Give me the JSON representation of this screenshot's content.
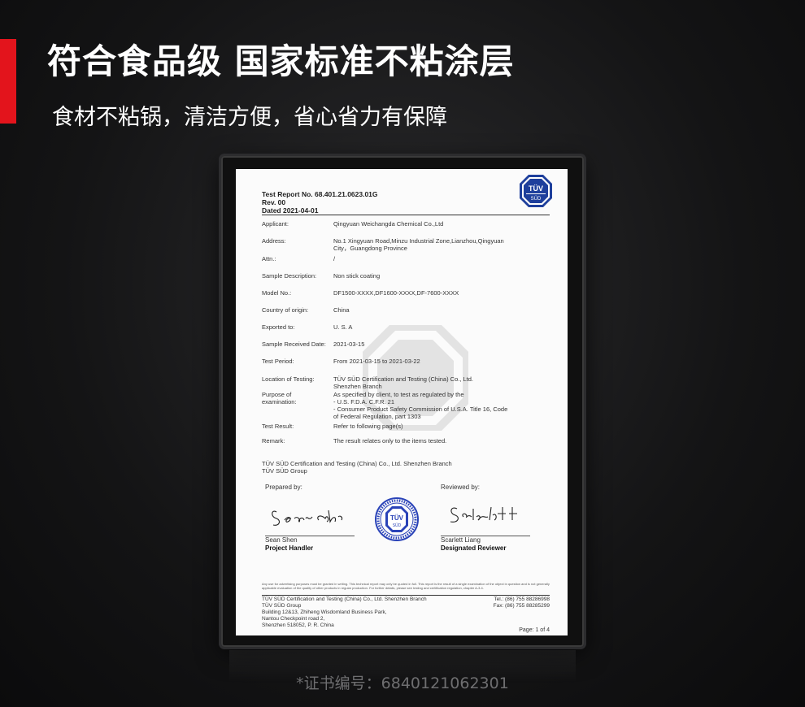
{
  "colors": {
    "accent": "#e3141c",
    "background": "#161617",
    "tuv_blue": "#1e3f9c"
  },
  "header": {
    "headline": "符合食品级 国家标准不粘涂层",
    "subline": "食材不粘锅，清洁方便，省心省力有保障"
  },
  "certificate": {
    "logo_text": "TÜV",
    "logo_subtext": "SÜD",
    "report_no": "Test Report No. 68.401.21.0623.01G",
    "rev": "Rev. 00",
    "dated": "Dated 2021-04-01",
    "fields": [
      {
        "label": "Applicant:",
        "value": [
          "Qingyuan Weichangda Chemical Co.,Ltd"
        ]
      },
      {
        "label": "Address:",
        "value": [
          "No.1 Xingyuan Road,Minzu Industrial Zone,Lianzhou,Qingyuan",
          "City，Guangdong Province"
        ]
      },
      {
        "label": "Attn.:",
        "value": [
          "/"
        ]
      },
      {
        "label": "Sample Description:",
        "value": [
          "Non stick coating"
        ]
      },
      {
        "label": "Model No.:",
        "value": [
          "DF1500-XXXX,DF1600-XXXX,DF-7600-XXXX"
        ]
      },
      {
        "label": "Country of origin:",
        "value": [
          "China"
        ]
      },
      {
        "label": "Exported to:",
        "value": [
          "U. S. A"
        ]
      },
      {
        "label": "Sample Received Date:",
        "value": [
          "2021-03-15"
        ]
      },
      {
        "label": "Test Period:",
        "value": [
          "From 2021-03-15 to 2021-03-22"
        ]
      },
      {
        "label": "Location of Testing:",
        "value": [
          "TÜV SÜD Certification and Testing (China) Co., Ltd.",
          "Shenzhen Branch"
        ]
      },
      {
        "label": "Purpose of examination:",
        "value": [
          "As specified by client, to test as regulated by the",
          "   -     U.S. F.D.A. C.F.R. 21",
          "   -     Consumer Product Safety Commission of U.S.A. Title 16, Code",
          "          of Federal Regulation, part 1303"
        ]
      },
      {
        "label": "Test Result:",
        "value": [
          "Refer to following page(s)"
        ]
      },
      {
        "label": "Remark:",
        "value": [
          "The result relates only to the items tested."
        ]
      }
    ],
    "org_line1": "TÜV SÜD Certification and Testing (China) Co., Ltd. Shenzhen Branch",
    "org_line2": "TÜV SÜD Group",
    "prepared_by": "Prepared by:",
    "reviewed_by": "Reviewed by:",
    "preparer_name": "Sean Shen",
    "preparer_role": "Project Handler",
    "reviewer_name": "Scarlett Liang",
    "reviewer_role": "Designated Reviewer",
    "fineprint": "Any use for advertising purposes must be granted in writing. This technical report may only be quoted in full. This report is the result of a single examination of the object in question and is not generally applicable evaluation of the quality of other products in regular production. For further details, please see testing and certification regulation, chapter A-3.4.",
    "footer_left": [
      "TÜV SÜD Certification and Testing (China) Co., Ltd. Shenzhen Branch",
      "TÜV SÜD Group",
      "Building 12&13,  Zhiheng Wisdomland Business Park,",
      "Nantou Checkpoint road  2,",
      "Shenzhen 518052,  P. R. China"
    ],
    "footer_right": [
      "Tel.: (86) 755 88286998",
      "Fax: (86) 755 88285299"
    ],
    "page": "Page: 1 of 4"
  },
  "cert_number": "*证书编号：6840121062301"
}
